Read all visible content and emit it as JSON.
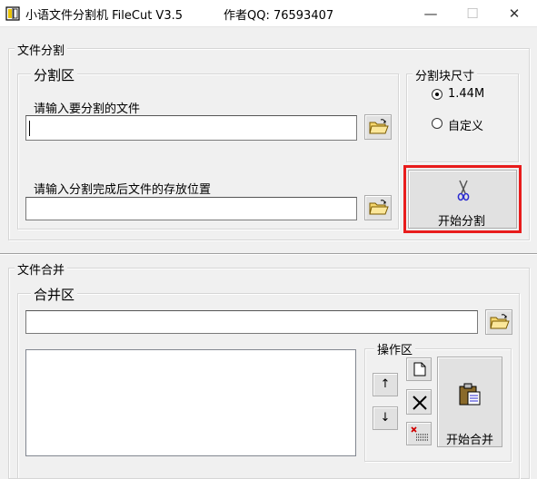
{
  "window": {
    "title": "小语文件分割机 FileCut V3.5",
    "author": "作者QQ:  76593407",
    "minimize_glyph": "—",
    "maximize_glyph": "☐",
    "close_glyph": "✕"
  },
  "split": {
    "group_title": "文件分割",
    "area_title": "分割区",
    "source_label": "请输入要分割的文件",
    "source_value": "",
    "dest_label": "请输入分割完成后文件的存放位置",
    "dest_value": "",
    "size_group_title": "分割块尺寸",
    "size_options": [
      {
        "label": "1.44M",
        "selected": true
      },
      {
        "label": "自定义",
        "selected": false
      }
    ],
    "start_button_label": "开始分割",
    "start_button_icon": "scissors-icon",
    "highlight_color": "#e81c1c"
  },
  "merge": {
    "group_title": "文件合并",
    "area_title": "合并区",
    "path_value": "",
    "ops_group_title": "操作区",
    "move_up_glyph": "↑",
    "move_down_glyph": "↓",
    "start_button_label": "开始合并",
    "start_button_icon": "clipboard-icon"
  }
}
